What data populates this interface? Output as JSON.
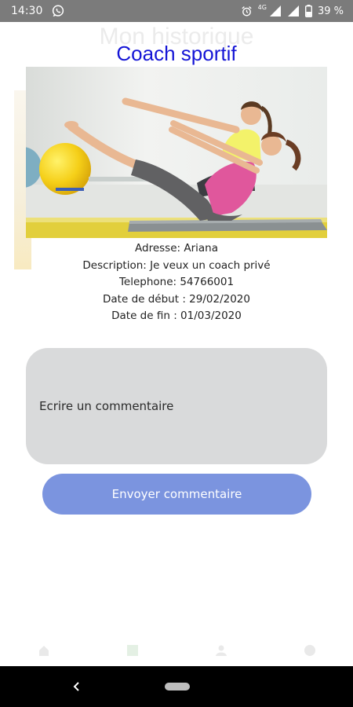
{
  "status_bar": {
    "time": "14:30",
    "network": "4G",
    "battery": "39 %",
    "icons": [
      "whatsapp-icon",
      "alarm-icon",
      "signal-icon",
      "battery-icon"
    ]
  },
  "background": {
    "title": "Mon historique"
  },
  "dialog": {
    "title": "Coach sportif",
    "details": {
      "address": "Adresse: Ariana",
      "description": "Description: Je veux un coach privé",
      "phone": "Telephone: 54766001",
      "start_date": "Date de début : 29/02/2020",
      "end_date": "Date de fin : 01/03/2020"
    },
    "comment_placeholder": "Ecrire un commentaire",
    "send_label": "Envoyer commentaire"
  },
  "colors": {
    "title": "#1515d6",
    "button": "#7b94df",
    "comment_box": "#d9dadb",
    "status_bar": "#7b7b7b"
  }
}
